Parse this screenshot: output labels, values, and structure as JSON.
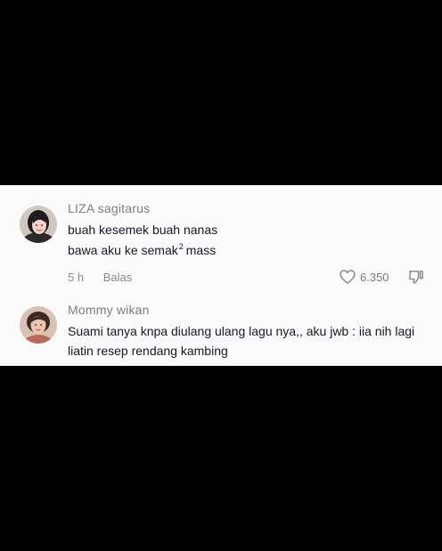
{
  "colors": {
    "background": "#000000",
    "panel": "#fafafa",
    "username": "#7d7d7d",
    "comment_text": "#161823",
    "meta": "#8a8a8a"
  },
  "comments": [
    {
      "username": "LIZA sagitarus",
      "lines": [
        "buah kesemek buah nanas",
        "bawa aku ke semak"
      ],
      "superscript": "2",
      "line2_suffix": "mass",
      "time": "5 h",
      "reply_label": "Balas",
      "likes": "6.350",
      "icons": {
        "like": "heart-outline-icon",
        "dislike": "thumbs-down-outline-icon"
      }
    },
    {
      "username": "Mommy wikan",
      "lines": [
        "Suami tanya knpa diulang ulang lagu nya,, aku jwb : iia nih lagi",
        "liatin resep rendang kambing"
      ]
    }
  ]
}
